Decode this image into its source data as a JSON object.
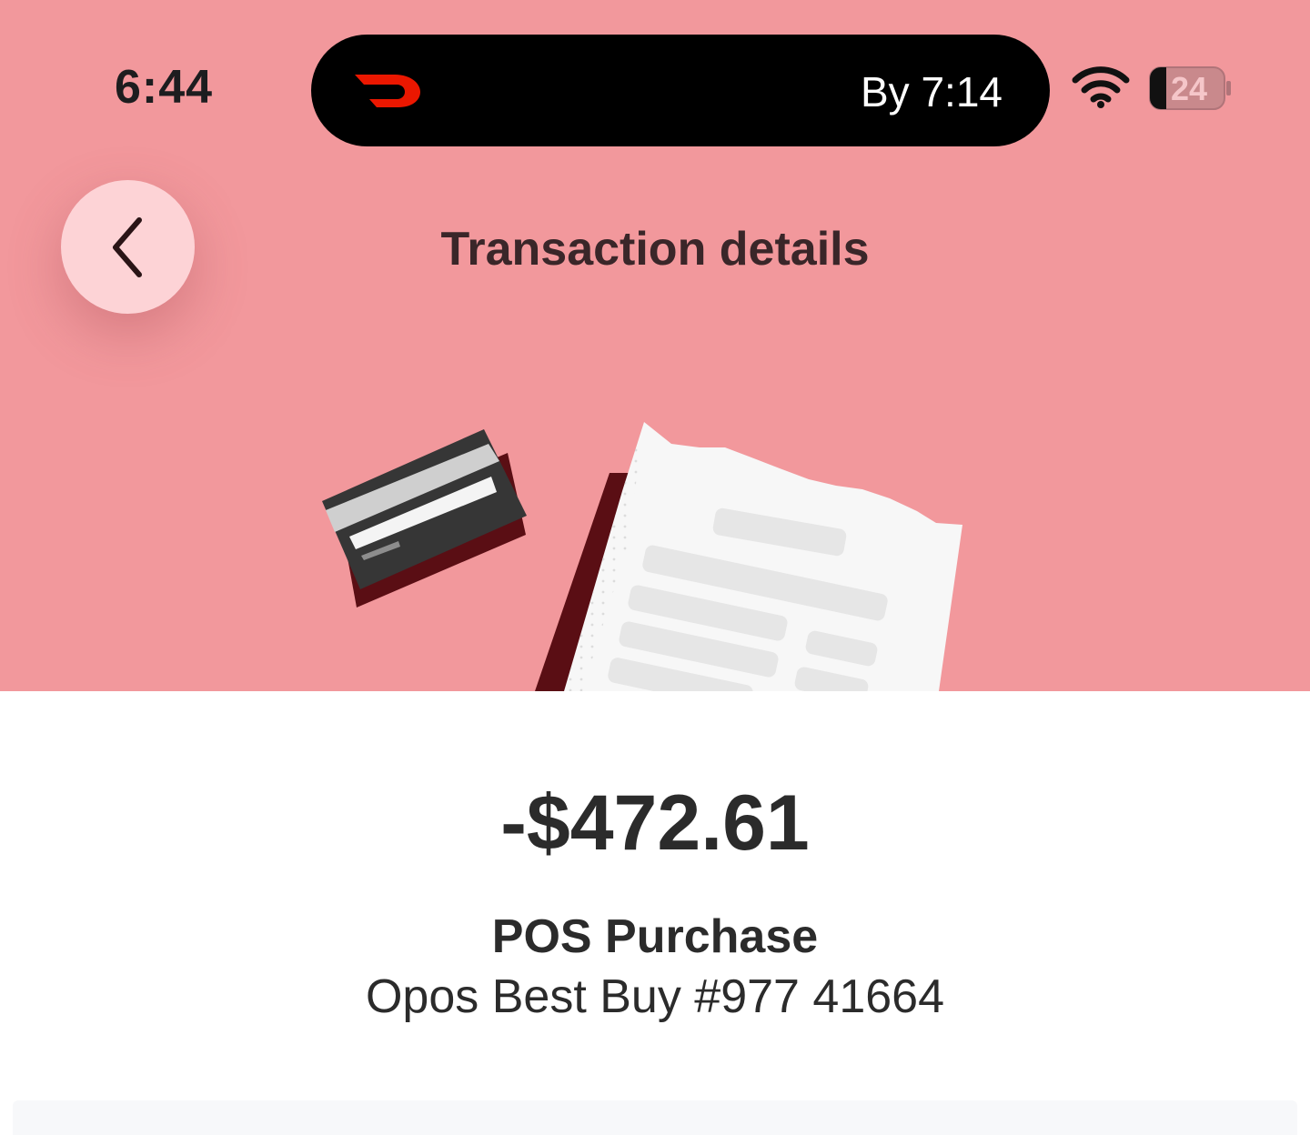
{
  "status_bar": {
    "time": "6:44",
    "live_activity": {
      "app_icon": "doordash-logo-icon",
      "eta_text": "By 7:14"
    },
    "wifi_icon": "wifi-icon",
    "battery_level": "24"
  },
  "header": {
    "back_icon": "chevron-left-icon",
    "title": "Transaction details"
  },
  "hero": {
    "background_color": "#f2989c",
    "illustration": [
      "credit-card-icon",
      "receipt-icon"
    ]
  },
  "transaction": {
    "amount": "-$472.61",
    "type": "POS Purchase",
    "merchant": "Opos Best Buy #977 41664"
  },
  "colors": {
    "brand_red": "#eb1700",
    "text_primary": "#2b2b2b"
  }
}
